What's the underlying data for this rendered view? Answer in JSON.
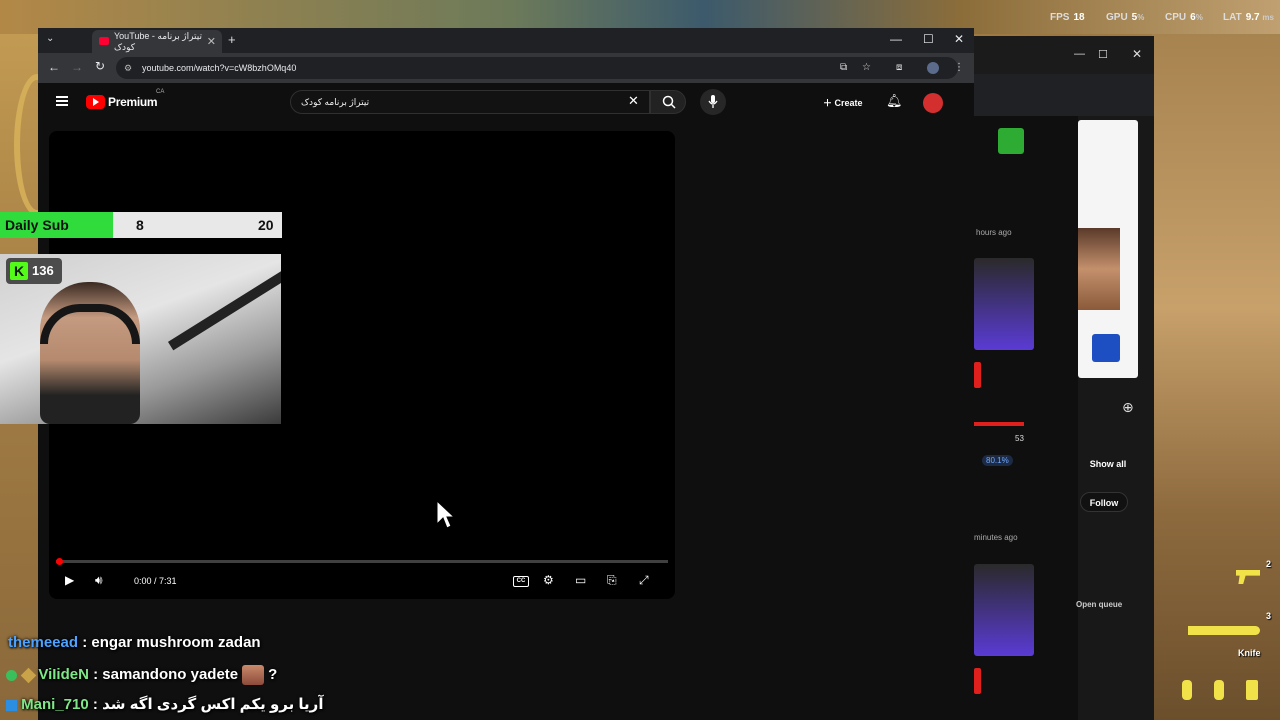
{
  "hud": {
    "fps_label": "FPS",
    "fps_value": "18",
    "gpu_label": "GPU",
    "gpu_value": "5",
    "cpu_label": "CPU",
    "cpu_value": "6",
    "lat_label": "LAT",
    "lat_value": "9.7",
    "lat_unit": "ms",
    "percent": "%"
  },
  "browser": {
    "tab_title": "YouTube - تیتراژ برنامه کودک",
    "new_tab": "+",
    "url": "youtube.com/watch?v=cW8bzhOMq40",
    "minimize": "—",
    "maximize": "☐",
    "close": "✕"
  },
  "youtube": {
    "logo_text": "Premium",
    "region": "CA",
    "search_value": "تیتراژ برنامه کودک",
    "create_label": "Create"
  },
  "player": {
    "time": "0:00 / 7:31",
    "progress_fraction": 0.0,
    "cc_label": "CC"
  },
  "overlay": {
    "sub_label": "Daily Sub",
    "sub_current": "8",
    "sub_goal": "20",
    "sub_fraction": 0.4,
    "kick_viewers": "136",
    "kick_logo": "K"
  },
  "chat": [
    {
      "user": "themeead",
      "sep": " : ",
      "message": "engar mushroom zadan"
    },
    {
      "user": "ViIideN",
      "sep": " : ",
      "message": "samandono yadete",
      "suffix": "?"
    },
    {
      "user": "Mani_710",
      "sep": " : ",
      "message": "آریا برو یکم اکس گردی اگه شد"
    }
  ],
  "back_window": {
    "hours_ago": "hours ago",
    "minutes_ago": "minutes ago",
    "count": "53",
    "percent": "80.1%",
    "show_all": "Show all",
    "follow": "Follow",
    "open_queue": "Open queue"
  },
  "game_hud": {
    "slot2": "2",
    "slot3": "3",
    "knife_label": "Knife"
  }
}
